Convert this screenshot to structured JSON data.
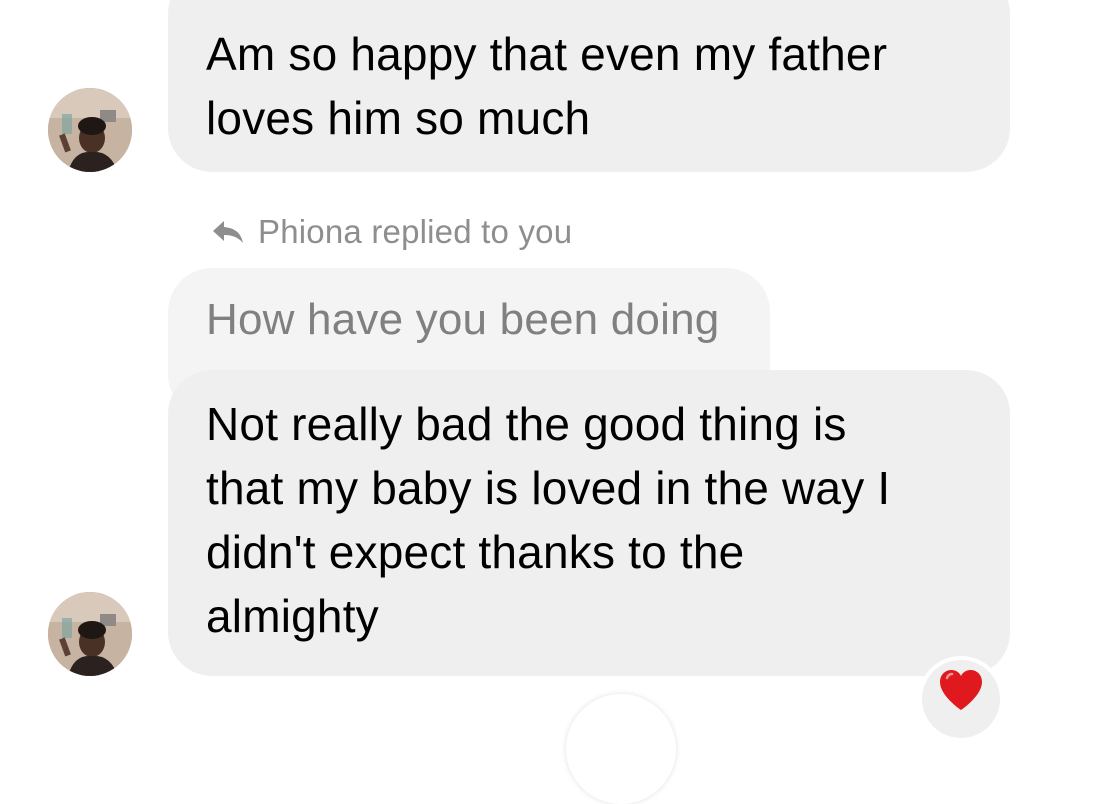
{
  "conversation": {
    "message_1": {
      "lines": [
        "Am so happy that even my father",
        "loves him so much"
      ]
    },
    "reply_notice": "Phiona replied to you",
    "quoted_message": "How have you been doing",
    "message_2": {
      "lines": [
        "Not really bad the good thing is",
        "that my baby is loved in the way I",
        "didn't expect thanks to the",
        "almighty"
      ]
    },
    "reaction": {
      "icon": "red-heart-icon",
      "color": "#e0191f"
    },
    "avatar_icon": "profile-photo-avatar"
  }
}
